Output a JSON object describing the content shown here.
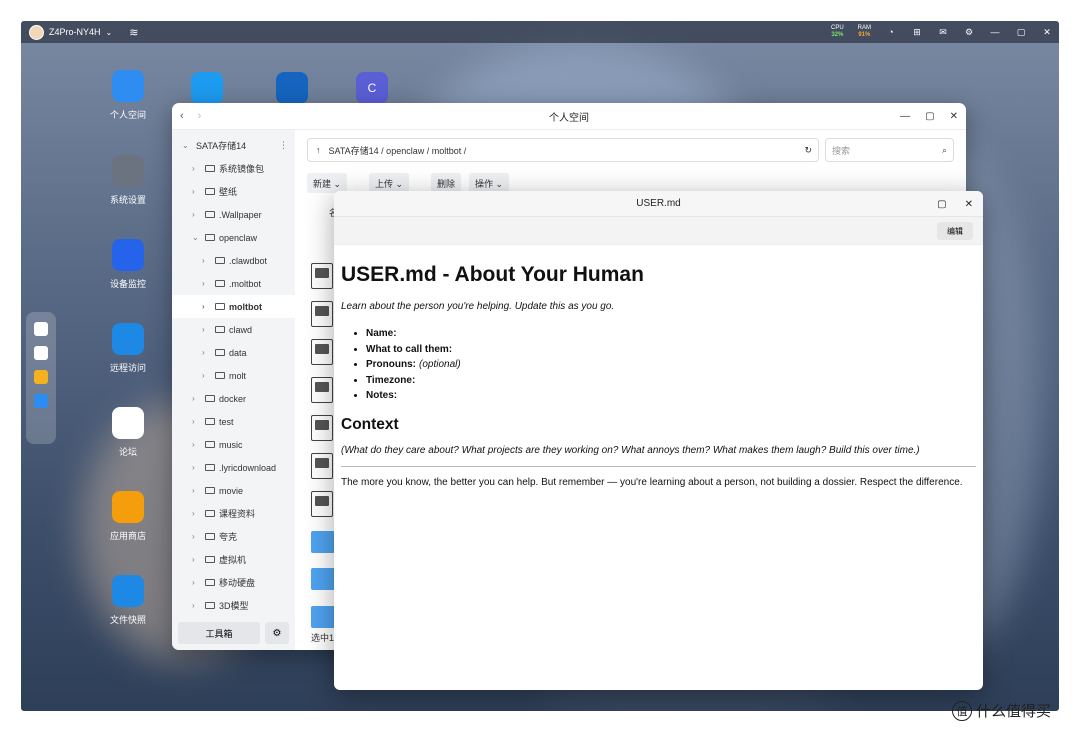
{
  "topbar": {
    "host": "Z4Pro-NY4H",
    "cpu_label": "CPU",
    "cpu_val": "32%",
    "ram_label": "RAM",
    "ram_val": "91%"
  },
  "desktop": {
    "icons": [
      {
        "label": "个人空间",
        "color": "#2f8cf0"
      },
      {
        "label": "系统设置",
        "color": "#6b7280"
      },
      {
        "label": "设备监控",
        "color": "#2563eb"
      },
      {
        "label": "远程访问",
        "color": "#1e88e5"
      },
      {
        "label": "论坛",
        "color": "#ffffff"
      },
      {
        "label": "应用商店",
        "color": "#f59e0b"
      },
      {
        "label": "文件快照",
        "color": "#1e88e5"
      }
    ]
  },
  "filemanager": {
    "title": "个人空间",
    "back": "‹",
    "forward": "›",
    "sidebar": [
      {
        "label": "SATA存储14",
        "indent": 0,
        "chev": "⌄",
        "folder": false,
        "more": "⋮"
      },
      {
        "label": "系统镜像包",
        "indent": 1,
        "chev": "›",
        "folder": true
      },
      {
        "label": "壁纸",
        "indent": 1,
        "chev": "›",
        "folder": true
      },
      {
        "label": ".Wallpaper",
        "indent": 1,
        "chev": "›",
        "folder": true
      },
      {
        "label": "openclaw",
        "indent": 1,
        "chev": "⌄",
        "folder": true
      },
      {
        "label": ".clawdbot",
        "indent": 2,
        "chev": "›",
        "folder": true
      },
      {
        "label": ".moltbot",
        "indent": 2,
        "chev": "›",
        "folder": true
      },
      {
        "label": "moltbot",
        "indent": 2,
        "chev": "›",
        "folder": true,
        "selected": true
      },
      {
        "label": "clawd",
        "indent": 2,
        "chev": "›",
        "folder": true
      },
      {
        "label": "data",
        "indent": 2,
        "chev": "›",
        "folder": true
      },
      {
        "label": "molt",
        "indent": 2,
        "chev": "›",
        "folder": true
      },
      {
        "label": "docker",
        "indent": 1,
        "chev": "›",
        "folder": true
      },
      {
        "label": "test",
        "indent": 1,
        "chev": "›",
        "folder": true
      },
      {
        "label": "music",
        "indent": 1,
        "chev": "›",
        "folder": true
      },
      {
        "label": ".lyricdownload",
        "indent": 1,
        "chev": "›",
        "folder": true
      },
      {
        "label": "movie",
        "indent": 1,
        "chev": "›",
        "folder": true
      },
      {
        "label": "课程资料",
        "indent": 1,
        "chev": "›",
        "folder": true
      },
      {
        "label": "夸克",
        "indent": 1,
        "chev": "›",
        "folder": true
      },
      {
        "label": "虚拟机",
        "indent": 1,
        "chev": "›",
        "folder": true
      },
      {
        "label": "移动硬盘",
        "indent": 1,
        "chev": "›",
        "folder": true
      },
      {
        "label": "3D模型",
        "indent": 1,
        "chev": "›",
        "folder": true
      }
    ],
    "toolbox": "工具箱",
    "path": "SATA存储14 / openclaw / moltbot /",
    "search_placeholder": "搜索",
    "buttons": {
      "new": "新建 ⌄",
      "upload": "上传 ⌄",
      "delete": "删除",
      "action": "操作 ⌄"
    },
    "column_header": "名",
    "status": "选中1"
  },
  "mdviewer": {
    "title": "USER.md",
    "edit": "编辑",
    "h1": "USER.md - About Your Human",
    "lead": "Learn about the person you're helping. Update this as you go.",
    "fields": [
      {
        "label": "Name:",
        "note": ""
      },
      {
        "label": "What to call them:",
        "note": ""
      },
      {
        "label": "Pronouns:",
        "note": "(optional)"
      },
      {
        "label": "Timezone:",
        "note": ""
      },
      {
        "label": "Notes:",
        "note": ""
      }
    ],
    "h2": "Context",
    "context_q": "(What do they care about? What projects are they working on? What annoys them? What makes them laugh? Build this over time.)",
    "body": "The more you know, the better you can help. But remember — you're learning about a person, not building a dossier. Respect the difference."
  },
  "watermark": "什么值得买",
  "watermark_logo": "值"
}
